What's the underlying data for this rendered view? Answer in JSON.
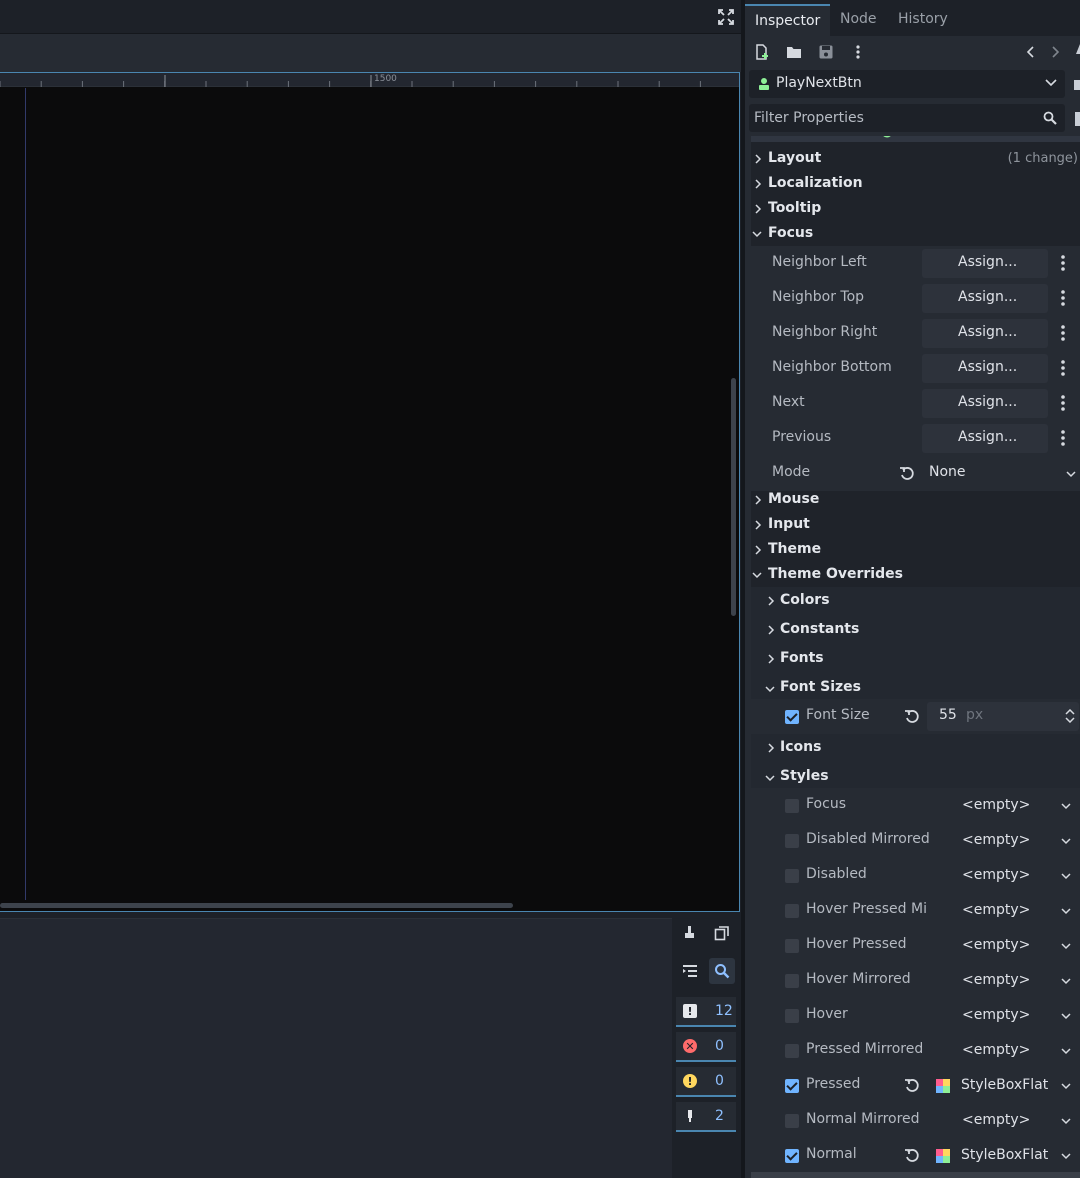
{
  "inspector": {
    "tabs": [
      "Inspector",
      "Node",
      "History"
    ],
    "node_name": "PlayNextBtn",
    "filter_placeholder": "Filter Properties",
    "categories": {
      "layout": "Layout",
      "layout_note": "(1 change)",
      "localization": "Localization",
      "tooltip": "Tooltip",
      "focus": "Focus",
      "mouse": "Mouse",
      "input": "Input",
      "theme": "Theme",
      "theme_overrides": "Theme Overrides"
    },
    "focus_props": [
      {
        "label": "Neighbor Left",
        "value": "Assign..."
      },
      {
        "label": "Neighbor Top",
        "value": "Assign..."
      },
      {
        "label": "Neighbor Right",
        "value": "Assign..."
      },
      {
        "label": "Neighbor Bottom",
        "value": "Assign..."
      },
      {
        "label": "Next",
        "value": "Assign..."
      },
      {
        "label": "Previous",
        "value": "Assign..."
      }
    ],
    "mode": {
      "label": "Mode",
      "value": "None"
    },
    "overrides": {
      "colors": "Colors",
      "constants": "Constants",
      "fonts": "Fonts",
      "font_sizes": "Font Sizes",
      "font_size": {
        "label": "Font Size",
        "value": "55",
        "unit": "px"
      },
      "icons": "Icons",
      "styles": "Styles"
    },
    "styles": [
      {
        "label": "Focus",
        "value": "<empty>",
        "checked": false
      },
      {
        "label": "Disabled Mirrored",
        "value": "<empty>",
        "checked": false
      },
      {
        "label": "Disabled",
        "value": "<empty>",
        "checked": false
      },
      {
        "label": "Hover Pressed Mi",
        "value": "<empty>",
        "checked": false
      },
      {
        "label": "Hover Pressed",
        "value": "<empty>",
        "checked": false
      },
      {
        "label": "Hover Mirrored",
        "value": "<empty>",
        "checked": false
      },
      {
        "label": "Hover",
        "value": "<empty>",
        "checked": false
      },
      {
        "label": "Pressed Mirrored",
        "value": "<empty>",
        "checked": false
      },
      {
        "label": "Pressed",
        "value": "StyleBoxFlat",
        "checked": true
      },
      {
        "label": "Normal Mirrored",
        "value": "<empty>",
        "checked": false
      },
      {
        "label": "Normal",
        "value": "StyleBoxFlat",
        "checked": true
      }
    ]
  },
  "viewport": {
    "ruler_label": "1500"
  },
  "output": {
    "counters": {
      "messages": "12",
      "errors": "0",
      "warnings": "0",
      "editor": "2"
    }
  },
  "colors": {
    "accent": "#4a86b0",
    "checkbox_on": "#70b4ff",
    "error": "#ff6b6b",
    "warning": "#ffd75e"
  }
}
